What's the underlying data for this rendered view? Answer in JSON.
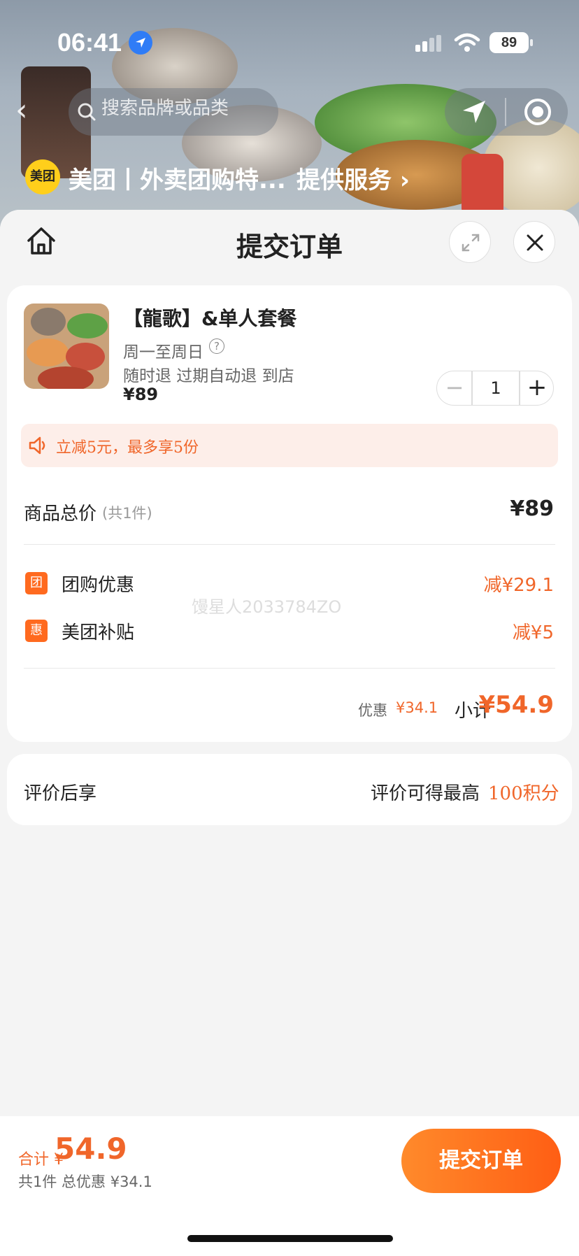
{
  "status_bar": {
    "time": "06:41",
    "battery": "89"
  },
  "topbar": {
    "search_placeholder": "搜索品牌或品类"
  },
  "mini_program": {
    "logo_text": "美团",
    "title": "美团丨外卖团购特...",
    "service": "提供服务 ›"
  },
  "sheet": {
    "title": "提交订单"
  },
  "product": {
    "name": "【龍歌】&单人套餐",
    "days": "周一至周日",
    "policy": "随时退 过期自动退 到店",
    "price": "¥89",
    "quantity": "1",
    "minus": "−",
    "plus": "+"
  },
  "promo": {
    "text": "立减5元，最多享5份"
  },
  "pricing": {
    "total_label": "商品总价",
    "total_count": "(共1件)",
    "total_value": "¥89",
    "discounts": [
      {
        "badge": "团",
        "label": "团购优惠",
        "value": "减¥29.1"
      },
      {
        "badge": "惠",
        "label": "美团补贴",
        "value": "减¥5"
      }
    ],
    "watermark": "馒星人2033784ZO",
    "saving_label": "优惠",
    "saving_value": "¥34.1",
    "subtotal_label": "小计",
    "subtotal_value": "¥54.9"
  },
  "review": {
    "label": "评价后享",
    "desc": "评价可得最高",
    "points": "100积分"
  },
  "bottom": {
    "sum_label": "合计 ¥",
    "sum_value": "54.9",
    "detail": "共1件 总优惠 ¥34.1",
    "submit_label": "提交订单"
  },
  "colors": {
    "accent": "#f0662a",
    "button": "#ff5e14",
    "meituan_yellow": "#ffcf1b"
  }
}
